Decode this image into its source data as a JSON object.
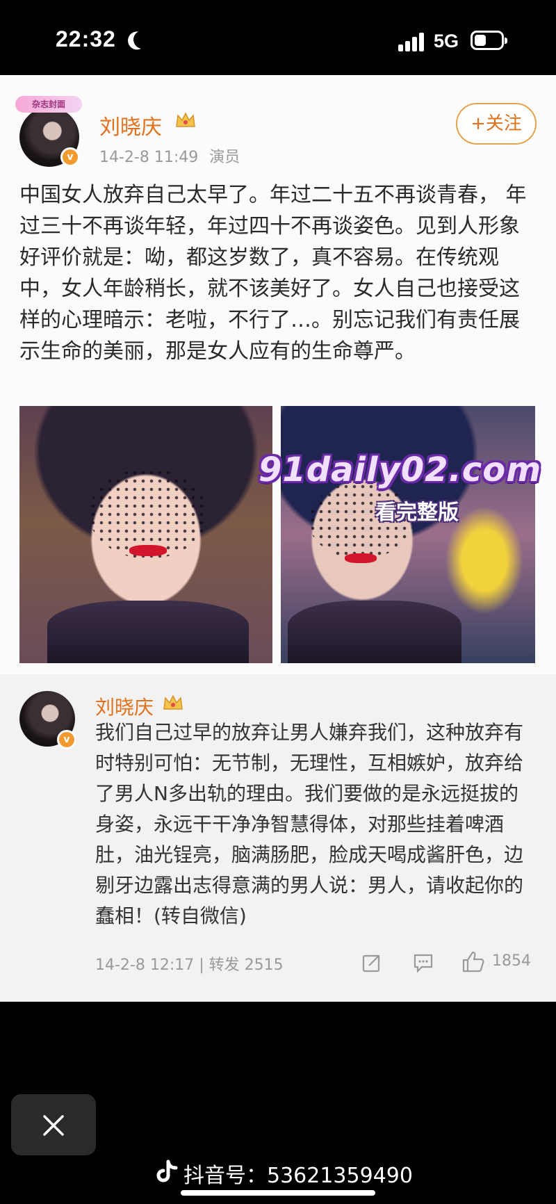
{
  "status_bar": {
    "time": "22:32",
    "network": "5G",
    "icons": [
      "moon-icon",
      "signal-icon",
      "battery-icon"
    ]
  },
  "post": {
    "avatar_badge": "杂志封面",
    "author": "刘晓庆",
    "timestamp": "14-2-8 11:49",
    "author_label": "演员",
    "follow_label": "+关注",
    "body": "中国女人放弃自己太早了。年过二十五不再谈青春， 年过三十不再谈年轻，年过四十不再谈姿色。见到人形象好评价就是：呦，都这岁数了，真不容易。在传统观中，女人年龄稍长，就不该美好了。女人自己也接受这样的心理暗示：老啦，不行了…。别忘记我们有责任展示生命的美丽，那是女人应有的生命尊严。",
    "watermark": "91daily02.com",
    "watermark_sub": "看完整版"
  },
  "repost": {
    "author": "刘晓庆",
    "text": "我们自己过早的放弃让男人嫌弃我们，这种放弃有时特别可怕：无节制，无理性，互相嫉妒，放弃给了男人N多出轨的理由。我们要做的是永远挺拔的身姿，永远干干净净智慧得体，对那些挂着啤酒肚，油光锃亮，脑满肠肥，脸成天喝成酱肝色，边剔牙边露出志得意满的男人说：男人，请收起你的蠢相！(转自微信)",
    "footer": "14-2-8 12:17 | 转发 2515",
    "like_count": "1854"
  },
  "overlay": {
    "douyin_id": "抖音号：53621359490"
  },
  "colors": {
    "accent_orange": "#e3701a",
    "background": "#000000"
  }
}
